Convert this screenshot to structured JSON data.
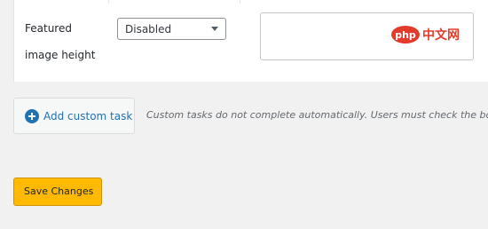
{
  "settings": {
    "featured_image_height_label_line1": "Featured",
    "featured_image_height_label_line2": "image height",
    "featured_image_height_value": "Disabled"
  },
  "custom_tasks": {
    "add_button_label": "Add custom task",
    "note": "Custom tasks do not complete automatically. Users must check the box"
  },
  "actions": {
    "save_label": "Save Changes"
  },
  "watermark": {
    "text_1": "php",
    "text_2": "中文网"
  },
  "colors": {
    "accent_blue": "#2271b1",
    "save_yellow": "#ffb900",
    "page_bg": "#f1f1f1"
  }
}
